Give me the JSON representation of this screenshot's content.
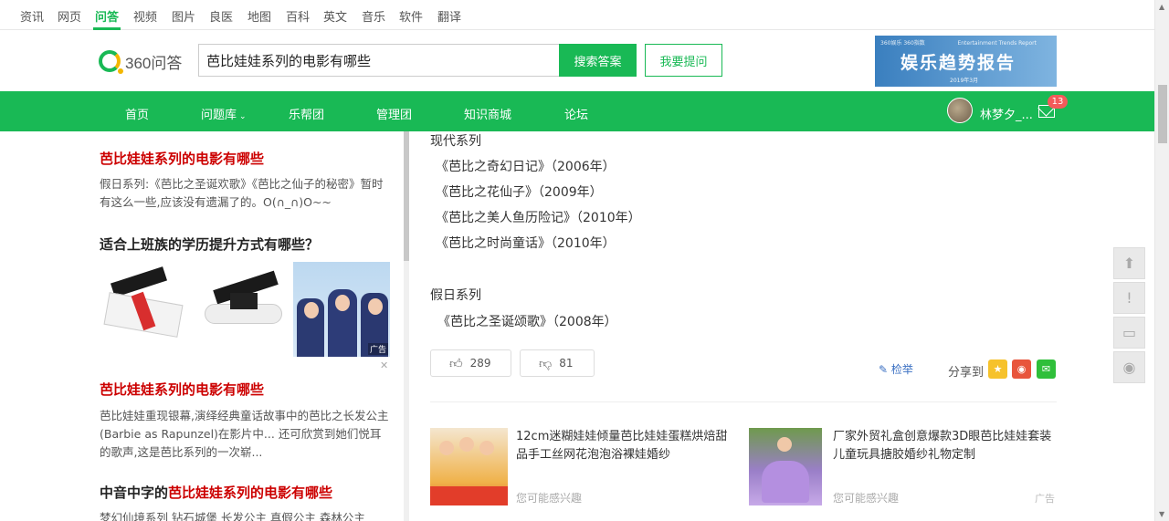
{
  "channels": [
    "资讯",
    "网页",
    "问答",
    "视频",
    "图片",
    "良医",
    "地图",
    "百科",
    "英文",
    "音乐",
    "软件",
    "翻译"
  ],
  "active_channel": "问答",
  "logo_text": "360问答",
  "search": {
    "value": "芭比娃娃系列的电影有哪些",
    "button": "搜索答案"
  },
  "ask_button": "我要提问",
  "banner": {
    "title": "娱乐趋势报告",
    "top_left": "360娱乐  360指数",
    "top_right": "Entertainment Trends Report",
    "date": "2019年3月"
  },
  "nav": {
    "items": [
      "首页",
      "问题库",
      "乐帮团",
      "管理团",
      "知识商城",
      "论坛"
    ],
    "user": "林梦夕_...",
    "mail_badge": "13"
  },
  "sidebar": {
    "card1": {
      "title": "芭比娃娃系列的电影有哪些",
      "text": "假日系列:《芭比之圣诞欢歌》《芭比之仙子的秘密》暂时有这么一些,应该没有遗漏了的。O(∩_∩)O~~"
    },
    "card2": {
      "title": "适合上班族的学历提升方式有哪些？",
      "ad_label": "广告",
      "close": "✕"
    },
    "card3": {
      "title": "芭比娃娃系列的电影有哪些",
      "text": "芭比娃娃重现银幕,演绎经典童话故事中的芭比之长发公主(Barbie as Rapunzel)在影片中... 还可欣赏到她们悦耳的歌声,这是芭比系列的一次崭..."
    },
    "card4": {
      "title_prefix": "中音中字的",
      "title_highlight": "芭比娃娃系列的电影有哪些",
      "text": "梦幻仙境系列 钻石城堡 长发公主 真假公主 森林公主"
    }
  },
  "answer": {
    "lines": [
      "现代系列",
      "《芭比之奇幻日记》（2006年）",
      "《芭比之花仙子》（2009年）",
      "《芭比之美人鱼历险记》（2010年）",
      "《芭比之时尚童话》（2010年）",
      "假日系列",
      "《芭比之圣诞颂歌》（2008年）"
    ],
    "likes": "289",
    "dislikes": "81",
    "report": "检举",
    "share_label": "分享到"
  },
  "recommend": [
    {
      "title": "12cm迷糊娃娃倾量芭比娃娃蛋糕烘焙甜品手工丝网花泡泡浴裸娃婚纱",
      "sub": "您可能感兴趣"
    },
    {
      "title": "厂家外贸礼盒创意爆款3D眼芭比娃娃套装儿童玩具搪胶婚纱礼物定制",
      "sub": "您可能感兴趣",
      "ad": "广告"
    }
  ],
  "colors": {
    "accent": "#19b955",
    "highlight": "#cc0000",
    "link": "#3a6fc2"
  }
}
